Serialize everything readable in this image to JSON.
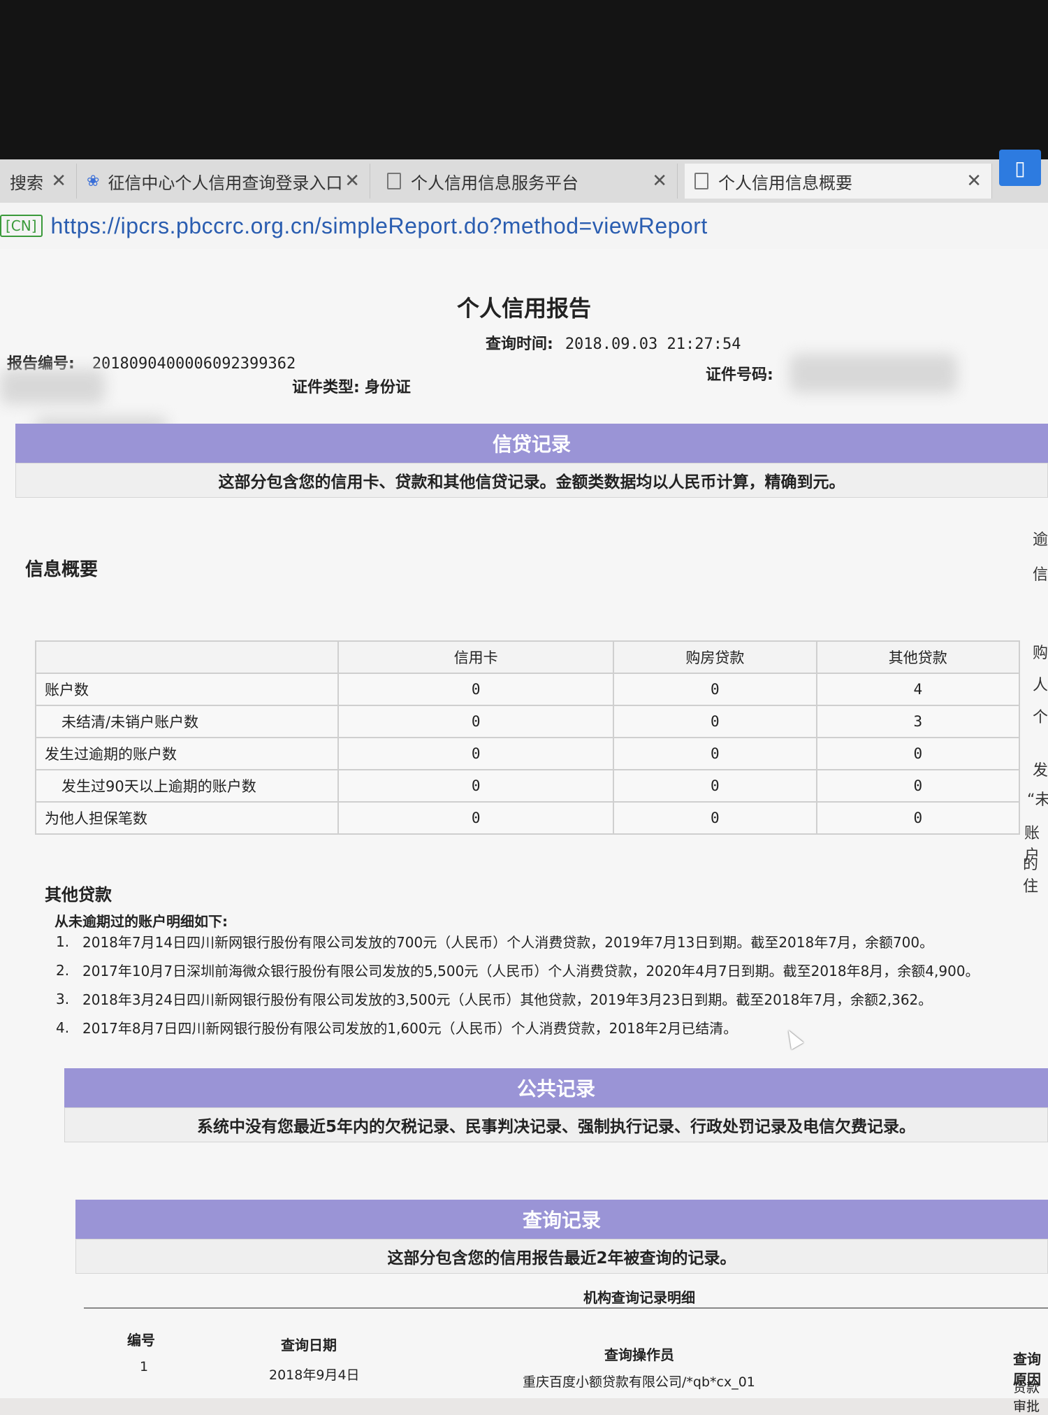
{
  "browser": {
    "tabs": [
      {
        "label": "搜索",
        "active": false
      },
      {
        "label": "征信中心个人信用查询登录入口",
        "active": false
      },
      {
        "label": "个人信用信息服务平台",
        "active": false
      },
      {
        "label": "个人信用信息概要",
        "active": true
      }
    ],
    "cn_badge": "[CN]",
    "url": "https://ipcrs.pbccrc.org.cn/simpleReport.do?method=viewReport"
  },
  "report": {
    "title": "个人信用报告",
    "report_no_label": "报告编号:",
    "report_no": "2018090400006092399362",
    "query_time_label": "查询时间:",
    "query_time": "2018.09.03 21:27:54",
    "id_type_label": "证件类型:",
    "id_type": "身份证",
    "id_no_label": "证件号码:"
  },
  "credit": {
    "heading": "信贷记录",
    "description": "这部分包含您的信用卡、贷款和其他信贷记录。金额类数据均以人民币计算，精确到元。",
    "summary_title": "信息概要",
    "columns": [
      "",
      "信用卡",
      "购房贷款",
      "其他贷款"
    ],
    "rows": [
      {
        "label": "账户数",
        "values": [
          "0",
          "0",
          "4"
        ]
      },
      {
        "label": "未结清/未销户账户数",
        "values": [
          "0",
          "0",
          "3"
        ]
      },
      {
        "label": "发生过逾期的账户数",
        "values": [
          "0",
          "0",
          "0"
        ]
      },
      {
        "label": "发生过90天以上逾期的账户数",
        "values": [
          "0",
          "0",
          "0"
        ]
      },
      {
        "label": "为他人担保笔数",
        "values": [
          "0",
          "0",
          "0"
        ]
      }
    ],
    "other_loans_title": "其他贷款",
    "no_overdue_title": "从未逾期过的账户明细如下:",
    "items": [
      {
        "num": "1.",
        "text": "2018年7月14日四川新网银行股份有限公司发放的700元（人民币）个人消费贷款，2019年7月13日到期。截至2018年7月，余额700。"
      },
      {
        "num": "2.",
        "text": "2017年10月7日深圳前海微众银行股份有限公司发放的5,500元（人民币）个人消费贷款，2020年4月7日到期。截至2018年8月，余额4,900。"
      },
      {
        "num": "3.",
        "text": "2018年3月24日四川新网银行股份有限公司发放的3,500元（人民币）其他贷款，2019年3月23日到期。截至2018年7月，余额2,362。"
      },
      {
        "num": "4.",
        "text": "2017年8月7日四川新网银行股份有限公司发放的1,600元（人民币）个人消费贷款，2018年2月已结清。"
      }
    ]
  },
  "public": {
    "heading": "公共记录",
    "description": "系统中没有您最近5年内的欠税记录、民事判决记录、强制执行记录、行政处罚记录及电信欠费记录。"
  },
  "query": {
    "heading": "查询记录",
    "description": "这部分包含您的信用报告最近2年被查询的记录。",
    "detail_title": "机构查询记录明细",
    "columns": [
      "编号",
      "查询日期",
      "查询操作员",
      "查询原因"
    ],
    "rows": [
      {
        "no": "1",
        "date": "2018年9月4日",
        "operator": "重庆百度小额贷款有限公司/*qb*cx_01",
        "reason": "贷款审批"
      }
    ]
  },
  "right_edge_fragments": [
    "逾",
    "信",
    "购",
    "人",
    "个",
    "发",
    "“未",
    "账户",
    "的住"
  ]
}
